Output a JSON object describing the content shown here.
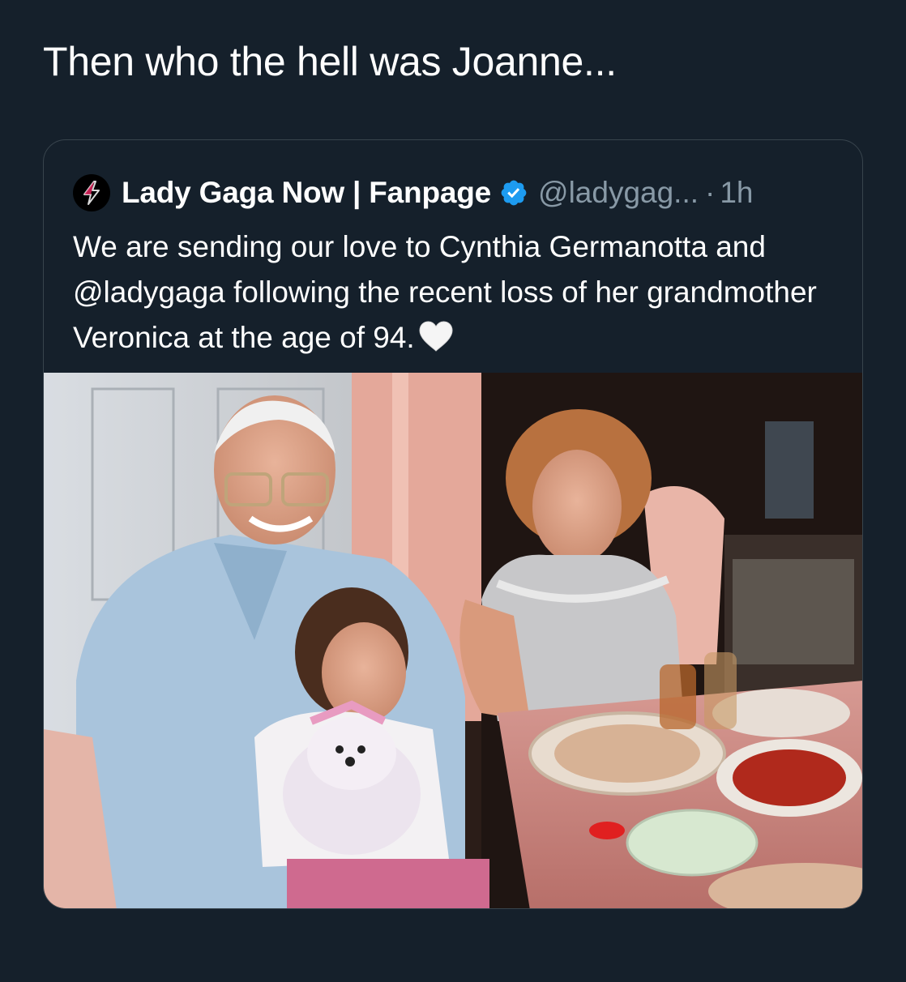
{
  "tweet": {
    "text": "Then who the hell was Joanne..."
  },
  "quoted_tweet": {
    "display_name": "Lady Gaga Now | Fanpage",
    "handle": "@ladygag...",
    "separator": "·",
    "time": "1h",
    "verified": true,
    "avatar_icon": "lightning-bolt-icon",
    "body": "We are sending our love to Cynthia Germanotta and @ladygaga following the recent loss of her grandmother Veronica at the age of 94.",
    "emoji": "white-heart-icon",
    "photo_alt": "photo-of-family-at-dinner-table"
  },
  "colors": {
    "background": "#15202b",
    "border": "#38444d",
    "secondary_text": "#8899a6",
    "verified_blue": "#1d9bf0"
  }
}
